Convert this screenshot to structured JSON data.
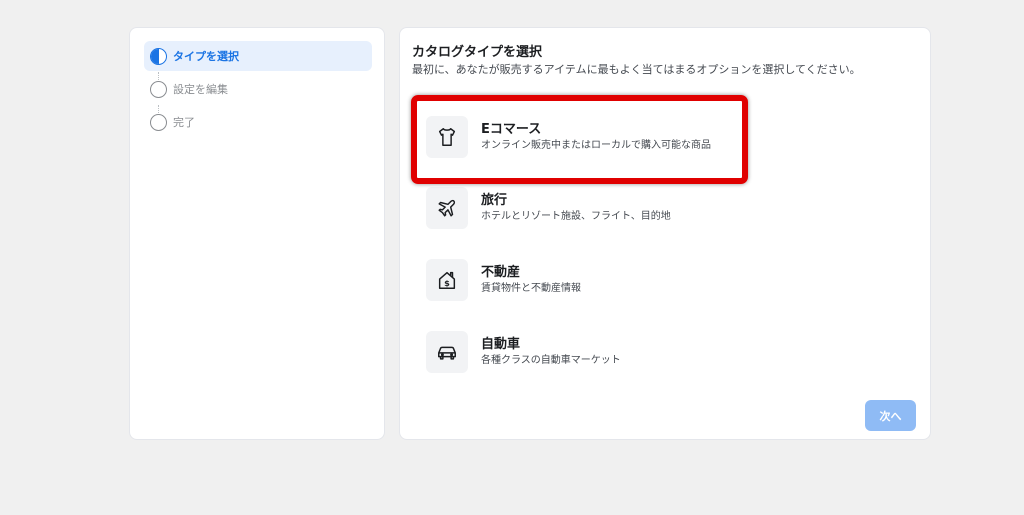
{
  "steps": [
    {
      "label": "タイプを選択",
      "state": "active"
    },
    {
      "label": "設定を編集",
      "state": "pending"
    },
    {
      "label": "完了",
      "state": "pending"
    }
  ],
  "main": {
    "title": "カタログタイプを選択",
    "subtitle": "最初に、あなたが販売するアイテムに最もよく当てはまるオプションを選択してください。",
    "options": [
      {
        "title": "Eコマース",
        "desc": "オンライン販売中またはローカルで購入可能な商品",
        "icon": "tshirt-icon"
      },
      {
        "title": "旅行",
        "desc": "ホテルとリゾート施設、フライト、目的地",
        "icon": "airplane-icon"
      },
      {
        "title": "不動産",
        "desc": "賃貸物件と不動産情報",
        "icon": "house-dollar-icon"
      },
      {
        "title": "自動車",
        "desc": "各種クラスの自動車マーケット",
        "icon": "car-icon"
      }
    ],
    "next_label": "次へ"
  },
  "colors": {
    "accent": "#1b74e4",
    "highlight": "#e00000",
    "next_disabled": "#8fbbf5"
  }
}
